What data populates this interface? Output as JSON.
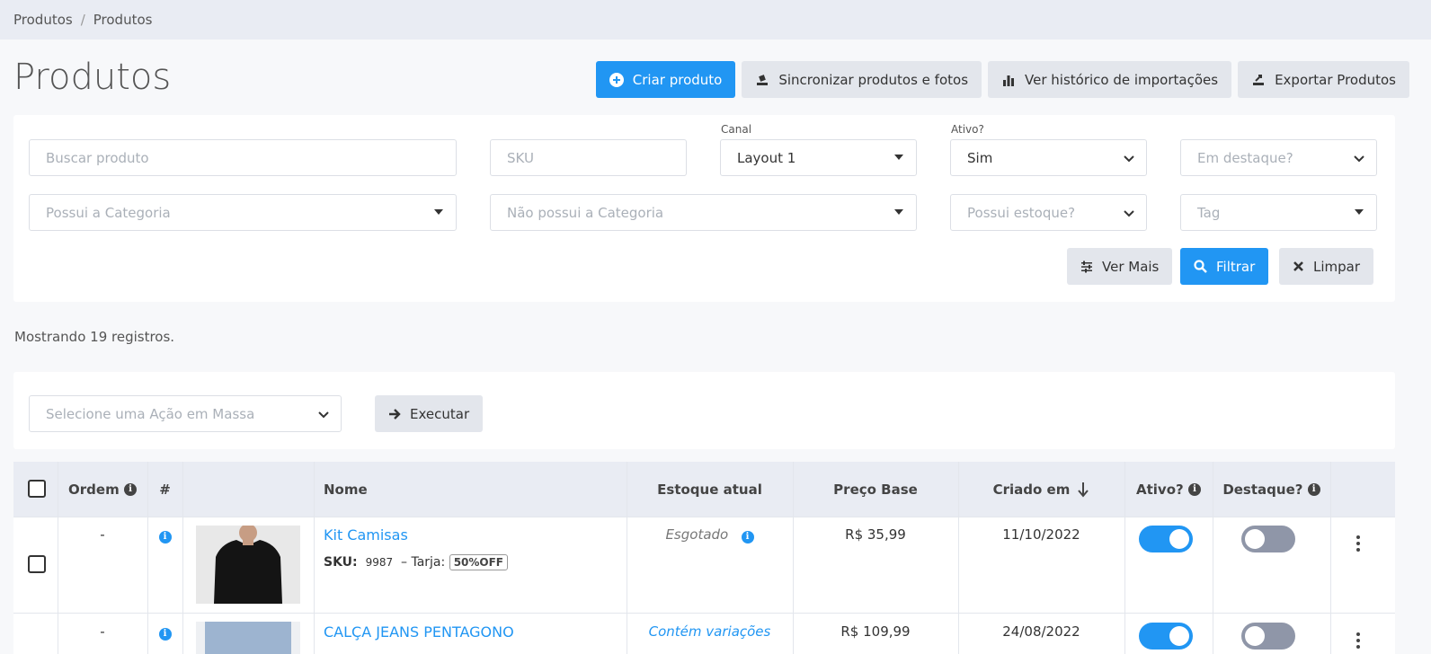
{
  "breadcrumb": {
    "items": [
      "Produtos",
      "Produtos"
    ],
    "separator": "/"
  },
  "page": {
    "title": "Produtos"
  },
  "actions": {
    "create": "Criar produto",
    "sync": "Sincronizar produtos e fotos",
    "history": "Ver histórico de importações",
    "export": "Exportar Produtos"
  },
  "filters": {
    "search_placeholder": "Buscar produto",
    "sku_placeholder": "SKU",
    "canal_label": "Canal",
    "canal_value": "Layout 1",
    "ativo_label": "Ativo?",
    "ativo_value": "Sim",
    "destaque_placeholder": "Em destaque?",
    "has_category_placeholder": "Possui a Categoria",
    "not_category_placeholder": "Não possui a Categoria",
    "stock_placeholder": "Possui estoque?",
    "tag_placeholder": "Tag",
    "more_button": "Ver Mais",
    "filter_button": "Filtrar",
    "clear_button": "Limpar"
  },
  "count_text": "Mostrando 19 registros.",
  "bulk": {
    "placeholder": "Selecione uma Ação em Massa",
    "execute": "Executar"
  },
  "table": {
    "headers": {
      "ordem": "Ordem",
      "hash": "#",
      "nome": "Nome",
      "estoque": "Estoque atual",
      "preco": "Preço Base",
      "criado": "Criado em",
      "ativo": "Ativo?",
      "destaque": "Destaque?"
    },
    "rows": [
      {
        "ordem": "-",
        "name": "Kit Camisas",
        "sku_label": "SKU:",
        "sku": "9987",
        "tarja_label": "– Tarja:",
        "tarja": "50%OFF",
        "stock": "Esgotado",
        "price": "R$ 35,99",
        "created": "11/10/2022",
        "active": true,
        "featured": false
      },
      {
        "ordem": "-",
        "name": "CALÇA JEANS PENTAGONO",
        "stock": "Contém variações",
        "price": "R$ 109,99",
        "created": "24/08/2022",
        "active": true,
        "featured": false
      }
    ]
  },
  "colors": {
    "primary": "#2196f3",
    "light_button": "#e3e6ec",
    "header_bg": "#e9ecf3"
  }
}
